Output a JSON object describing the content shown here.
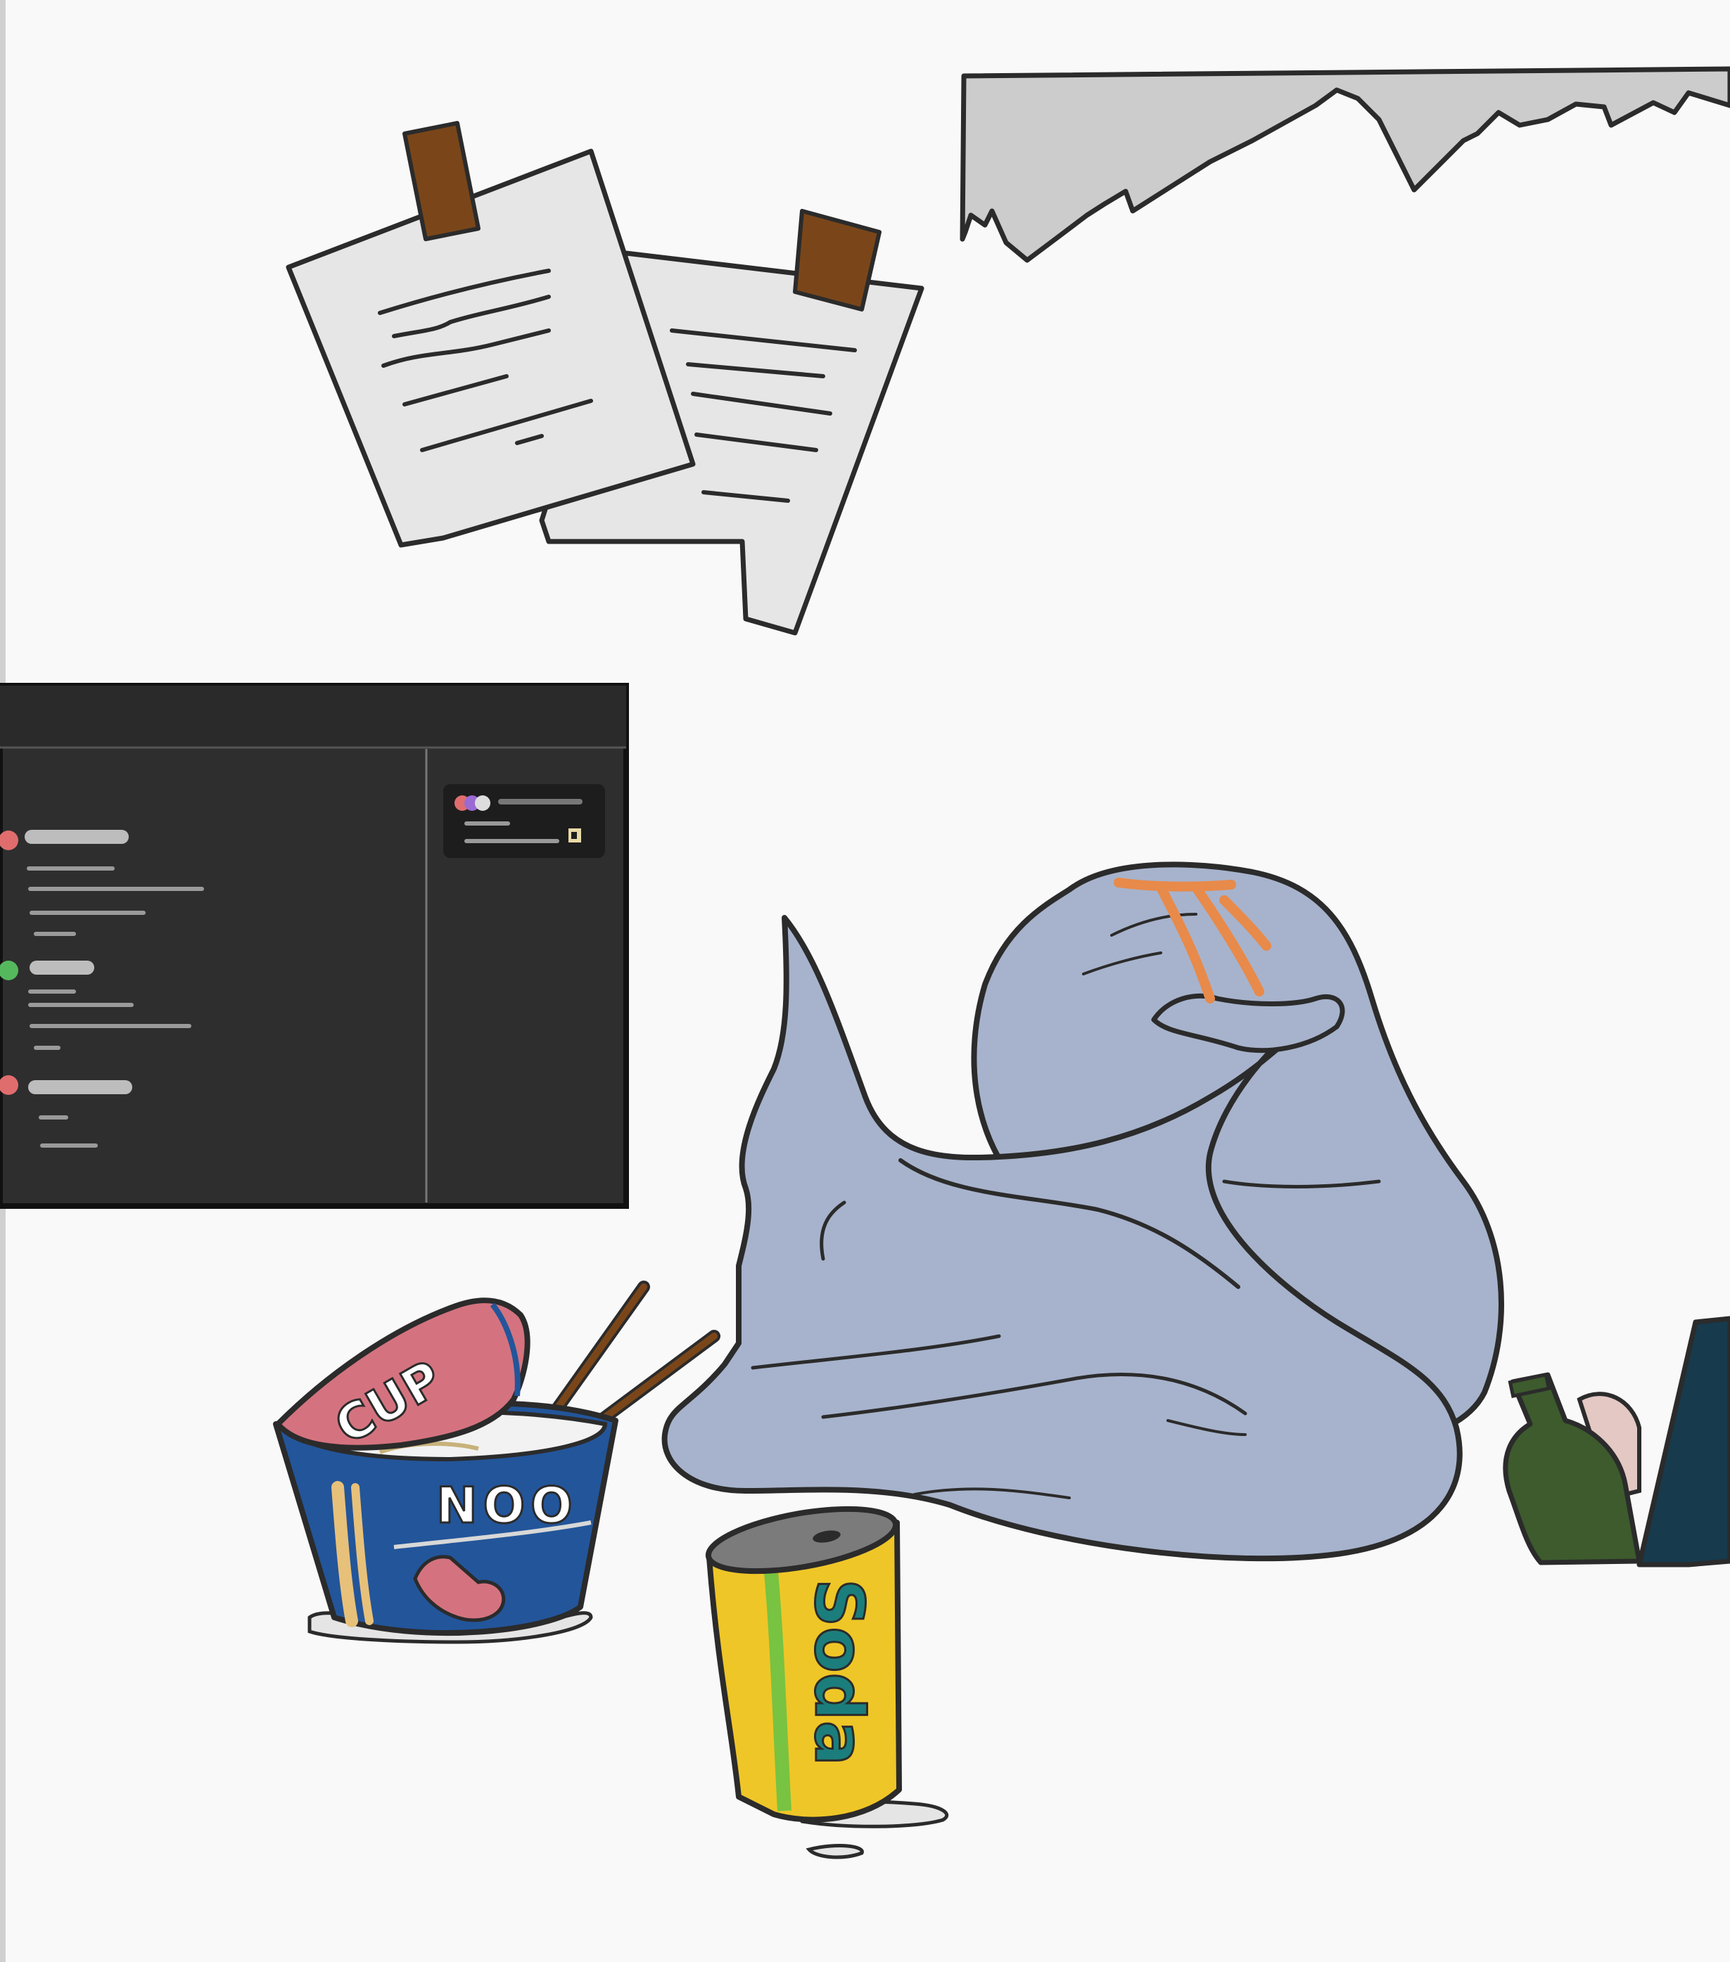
{
  "cup_lid_text": "CUP",
  "noodle_cup_text": "NOO",
  "soda_can_text": "Soda",
  "colors": {
    "background": "#f9f9f9",
    "outline": "#2b2b2b",
    "paper": "#e6e6e6",
    "tape": "#7a4619",
    "shelf": "#cccccc",
    "screen_body": "#2e2e2e",
    "screen_bar": "#2a2a2a",
    "bag": "#a7b3cc",
    "bag_tie": "#e88a4a",
    "noodle_cup": "#23559a",
    "noodle_lid": "#d4737f",
    "soda_can": "#efc627",
    "soda_stripe": "#78c341",
    "soda_text": "#1b7e7c",
    "bottle": "#3d5b2d",
    "box": "#173a4c",
    "status_red": "#e06d6d",
    "status_green": "#56b85c"
  },
  "icons": [
    "pinned-note-icon",
    "tape-icon",
    "bottle-icon"
  ]
}
